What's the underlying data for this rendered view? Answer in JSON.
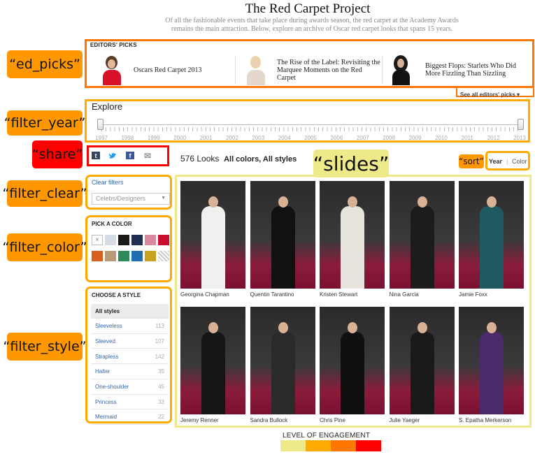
{
  "header": {
    "title": "The Red Carpet Project",
    "subtitle_line1": "Of all the fashionable events that take place during awards season, the red carpet at the Academy Awards",
    "subtitle_line2": "remains the main attraction. Below, explore an archive of Oscar red carpet looks that spans 15 years."
  },
  "annotations": {
    "ed_picks": "“ed_picks”",
    "filter_year": "“filter_year”",
    "share": "“share”",
    "filter_clear": "“filter_clear”",
    "filter_color": "“filter_color”",
    "filter_style": "“filter_style”",
    "slides": "“slides”",
    "sort": "“sort”"
  },
  "editors_picks": {
    "heading": "EDITORS' PICKS",
    "items": [
      {
        "label": "Oscars Red Carpet 2013"
      },
      {
        "label": "The Rise of the Label: Revisiting the Marquee Moments on the Red Carpet"
      },
      {
        "label": "Biggest Flops: Starlets Who Did More Fizzling Than Sizzling"
      }
    ],
    "see_all": "See all editors' picks ▾"
  },
  "timeline": {
    "heading": "Explore",
    "years": [
      "1997",
      "1998",
      "1999",
      "2000",
      "2001",
      "2002",
      "2003",
      "2004",
      "2005",
      "2006",
      "2007",
      "2008",
      "2009",
      "2010",
      "2011",
      "2012",
      "2013"
    ],
    "range_start": "1997",
    "range_end": "2013"
  },
  "share": {
    "icons": [
      "tumblr-icon",
      "twitter-icon",
      "facebook-icon",
      "email-icon"
    ],
    "glyphs": [
      "t",
      "🐦",
      "f",
      "✉"
    ]
  },
  "results": {
    "count": "576 Looks",
    "filters": "All colors, All styles"
  },
  "sort": {
    "year": "Year",
    "separator": "|",
    "color": "Color"
  },
  "filter_clear": {
    "link": "Clear filters",
    "select_placeholder": "Celebs/Designers"
  },
  "colors": {
    "heading": "PICK A COLOR",
    "swatches": [
      "#ffffff",
      "#d6dbe6",
      "#1a1a1a",
      "#1e2f52",
      "#d98aa0",
      "#c8102e",
      "#d7601f",
      "#b89a78",
      "#2f8a5a",
      "#1f6fb0",
      "#c8a220",
      "#e8e8e8"
    ]
  },
  "styles": {
    "heading": "CHOOSE A STYLE",
    "items": [
      {
        "label": "All styles",
        "count": ""
      },
      {
        "label": "Sleeveless",
        "count": "113"
      },
      {
        "label": "Sleeved",
        "count": "107"
      },
      {
        "label": "Strapless",
        "count": "142"
      },
      {
        "label": "Halter",
        "count": "35"
      },
      {
        "label": "One-shoulder",
        "count": "45"
      },
      {
        "label": "Princess",
        "count": "33"
      },
      {
        "label": "Mermaid",
        "count": "22"
      }
    ]
  },
  "slides": [
    {
      "name": "Georgina Chapman",
      "outfit": "#f0f0ee"
    },
    {
      "name": "Quentin Tarantino",
      "outfit": "#111111"
    },
    {
      "name": "Kristen Stewart",
      "outfit": "#e6e3dc"
    },
    {
      "name": "Nina Garcia",
      "outfit": "#1c1c1c"
    },
    {
      "name": "Jamie Foxx",
      "outfit": "#1f5a62"
    },
    {
      "name": "Jeremy Renner",
      "outfit": "#151515"
    },
    {
      "name": "Sandra Bullock",
      "outfit": "#2a2a2a"
    },
    {
      "name": "Chris Pine",
      "outfit": "#101010"
    },
    {
      "name": "Julie Yaeger",
      "outfit": "#1a1a1a"
    },
    {
      "name": "S. Epatha Merkerson",
      "outfit": "#4a2a6a"
    }
  ],
  "legend": {
    "title": "LEVEL OF ENGAGEMENT",
    "colors": [
      "#eeea8a",
      "#ffaa00",
      "#ff7700",
      "#ff0000"
    ]
  }
}
